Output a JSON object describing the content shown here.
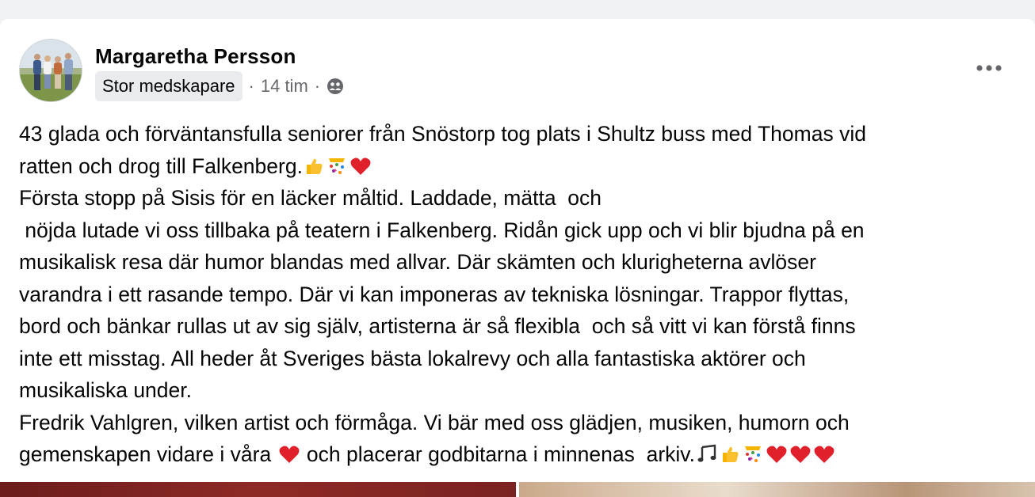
{
  "post": {
    "author": "Margaretha Persson",
    "badge": "Stor medskapare",
    "separator": "·",
    "time": "14 tim",
    "privacy_icon": "group-icon",
    "more_icon": "more-horizontal-icon",
    "lines": [
      "43 glada och förväntansfulla seniorer från Snöstorp tog plats i Shultz buss med Thomas vid",
      "ratten och drog till Falkenberg.",
      "Första stopp på Sisis för en läcker måltid. Laddade, mätta  och",
      " nöjda lutade vi oss tillbaka på teatern i Falkenberg. Ridån gick upp och vi blir bjudna på en",
      "musikalisk resa där humor blandas med allvar. Där skämten och klurigheterna avlöser",
      "varandra i ett rasande tempo. Där vi kan imponeras av tekniska lösningar. Trappor flyttas,",
      "bord och bänkar rullas ut av sig själv, artisterna är så flexibla  och så vitt vi kan förstå finns",
      "inte ett misstag. All heder åt Sveriges bästa lokalrevy och alla fantastiska aktörer och",
      "musikaliska under.",
      "Fredrik Vahlgren, vilken artist och förmåga. Vi bär med oss glädjen, musiken, humorn och",
      "gemenskapen vidare i våra",
      " och placerar godbitarna i minnenas  arkiv."
    ],
    "emoji": {
      "thumbs": "thumbs-up-icon",
      "confetti": "confetti-icon",
      "heart": "red-heart-icon",
      "notes": "music-notes-icon",
      "heart_color": "#e0202b"
    }
  }
}
